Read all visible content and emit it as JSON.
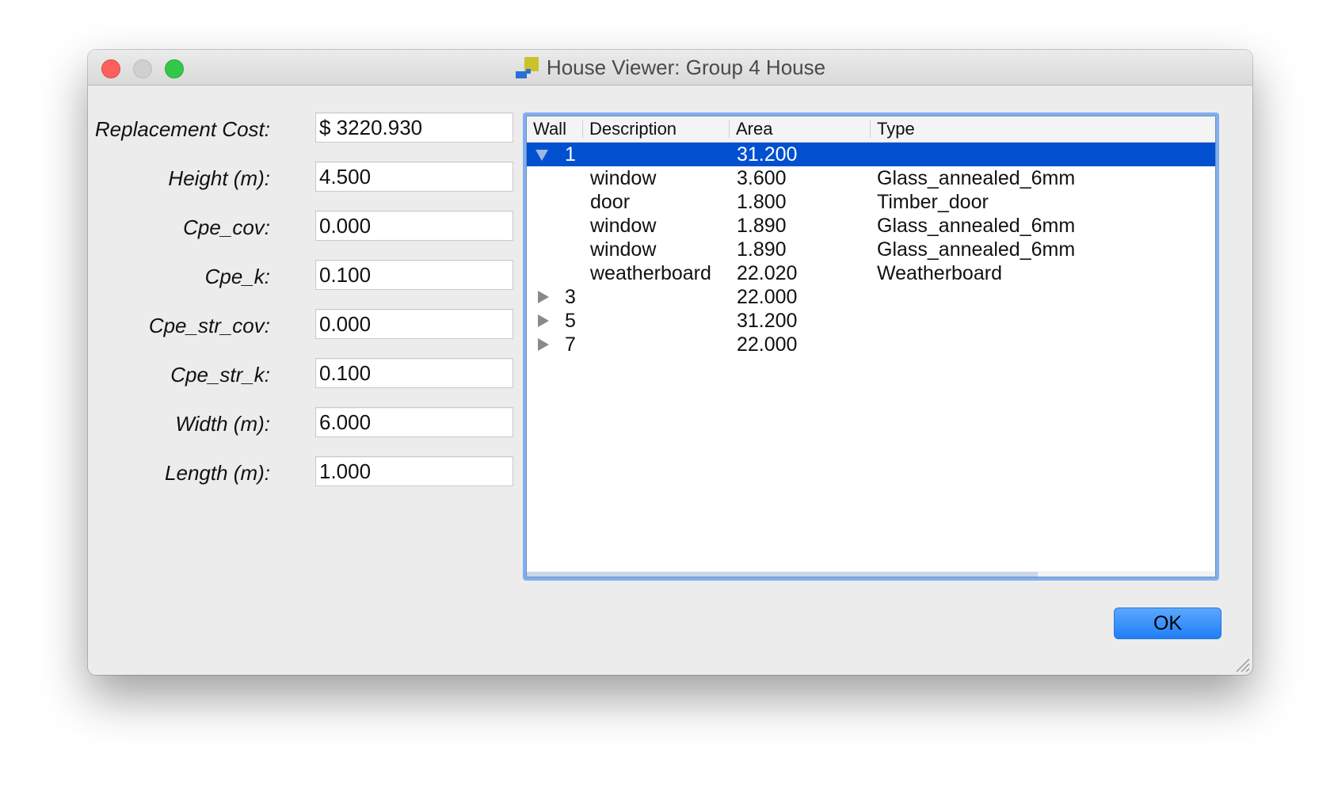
{
  "window": {
    "title": "House Viewer: Group 4 House"
  },
  "form": {
    "fields": [
      {
        "label": "Replacement Cost:",
        "value": "$ 3220.930"
      },
      {
        "label": "Height (m):",
        "value": "4.500"
      },
      {
        "label": "Cpe_cov:",
        "value": "0.000"
      },
      {
        "label": "Cpe_k:",
        "value": "0.100"
      },
      {
        "label": "Cpe_str_cov:",
        "value": "0.000"
      },
      {
        "label": "Cpe_str_k:",
        "value": "0.100"
      },
      {
        "label": "Width (m):",
        "value": "6.000"
      },
      {
        "label": "Length (m):",
        "value": "1.000"
      }
    ]
  },
  "tree": {
    "columns": [
      "Wall",
      "Description",
      "Area",
      "Type"
    ],
    "rows": [
      {
        "wall": "1",
        "description": "",
        "area": "31.200",
        "type": "",
        "expander": "expanded",
        "selected": true
      },
      {
        "wall": "",
        "description": "window",
        "area": "3.600",
        "type": "Glass_annealed_6mm",
        "expander": "none",
        "selected": false
      },
      {
        "wall": "",
        "description": "door",
        "area": "1.800",
        "type": "Timber_door",
        "expander": "none",
        "selected": false
      },
      {
        "wall": "",
        "description": "window",
        "area": "1.890",
        "type": "Glass_annealed_6mm",
        "expander": "none",
        "selected": false
      },
      {
        "wall": "",
        "description": "window",
        "area": "1.890",
        "type": "Glass_annealed_6mm",
        "expander": "none",
        "selected": false
      },
      {
        "wall": "",
        "description": "weatherboard",
        "area": "22.020",
        "type": "Weatherboard",
        "expander": "none",
        "selected": false
      },
      {
        "wall": "3",
        "description": "",
        "area": "22.000",
        "type": "",
        "expander": "collapsed",
        "selected": false
      },
      {
        "wall": "5",
        "description": "",
        "area": "31.200",
        "type": "",
        "expander": "collapsed",
        "selected": false
      },
      {
        "wall": "7",
        "description": "",
        "area": "22.000",
        "type": "",
        "expander": "collapsed",
        "selected": false
      }
    ]
  },
  "buttons": {
    "ok_label": "OK"
  },
  "icons": {
    "close": "close-icon",
    "minimize": "minimize-icon",
    "zoom": "zoom-icon",
    "app": "house-viewer-app-icon",
    "expand": "disclosure-triangle-icon",
    "resize": "resize-grip-icon"
  },
  "colors": {
    "selection": "#0050d0",
    "focus_ring": "#80aef0",
    "ok_button": "#1f7ff5",
    "close": "#fc615d",
    "zoom": "#34c84a"
  }
}
